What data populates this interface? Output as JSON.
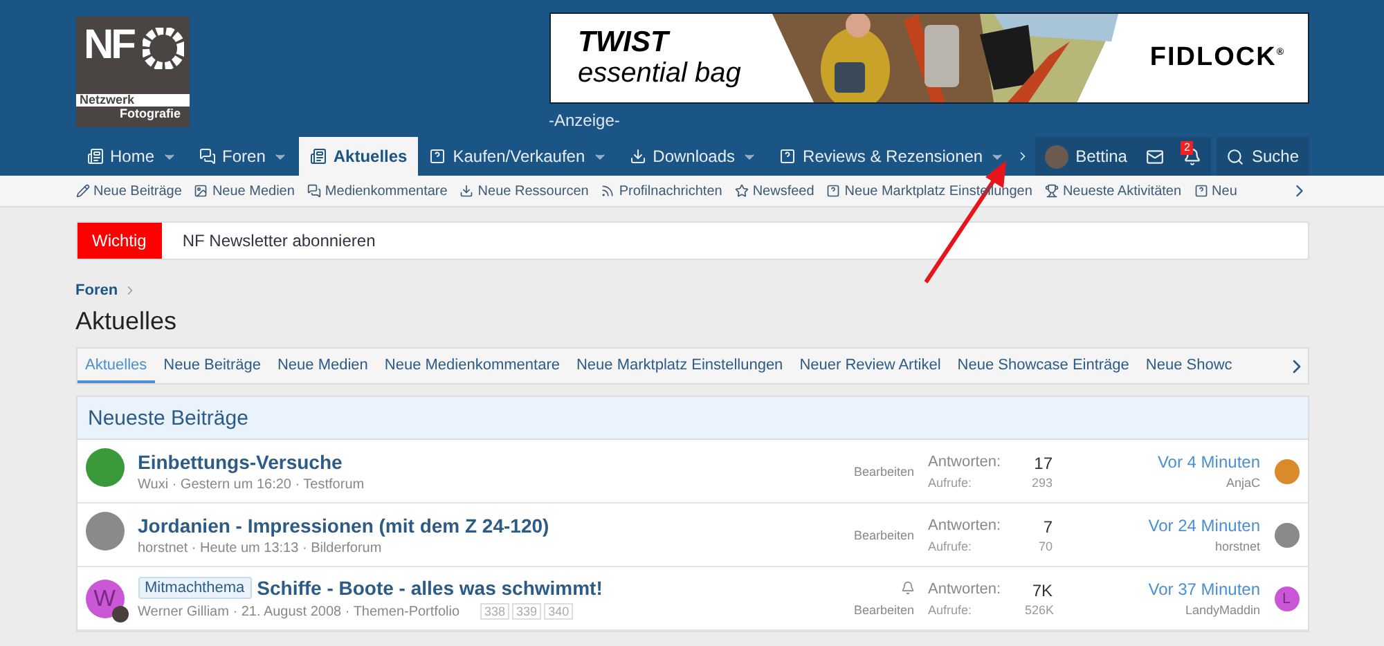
{
  "logo": {
    "letters": "NF",
    "line1": "Netzwerk",
    "line2": "Fotografie"
  },
  "ad": {
    "headline": "TWIST",
    "subline": "essential bag",
    "brand": "FIDLOCK",
    "mark": "®",
    "caption": "-Anzeige-"
  },
  "nav": [
    {
      "label": "Home",
      "dropdown": true,
      "selected": false
    },
    {
      "label": "Foren",
      "dropdown": true,
      "selected": false
    },
    {
      "label": "Aktuelles",
      "dropdown": false,
      "selected": true
    },
    {
      "label": "Kaufen/Verkaufen",
      "dropdown": true,
      "selected": false
    },
    {
      "label": "Downloads",
      "dropdown": true,
      "selected": false
    },
    {
      "label": "Reviews & Rezensionen",
      "dropdown": true,
      "selected": false
    }
  ],
  "user": {
    "name": "Bettina",
    "alerts": "2",
    "search": "Suche"
  },
  "subnav": [
    "Neue Beiträge",
    "Neue Medien",
    "Medienkommentare",
    "Neue Ressourcen",
    "Profilnachrichten",
    "Newsfeed",
    "Neue Marktplatz Einstellungen",
    "Neueste Aktivitäten",
    "Neu"
  ],
  "notice": {
    "tag": "Wichtig",
    "text": "NF Newsletter abonnieren"
  },
  "breadcrumb": "Foren",
  "title": "Aktuelles",
  "tabs": [
    {
      "label": "Aktuelles",
      "selected": true
    },
    {
      "label": "Neue Beiträge",
      "selected": false
    },
    {
      "label": "Neue Medien",
      "selected": false
    },
    {
      "label": "Neue Medienkommentare",
      "selected": false
    },
    {
      "label": "Neue Marktplatz Einstellungen",
      "selected": false
    },
    {
      "label": "Neuer Review Artikel",
      "selected": false
    },
    {
      "label": "Neue Showcase Einträge",
      "selected": false
    },
    {
      "label": "Neue Showc",
      "selected": false
    }
  ],
  "block": {
    "title": "Neueste Beiträge",
    "threads": [
      {
        "title": "Einbettungs-Versuche",
        "meta": "Wuxi · Gestern um 16:20 · Testforum",
        "watched": false,
        "edit": "Bearbeiten",
        "replies_label": "Antworten:",
        "replies": "17",
        "views_label": "Aufrufe:",
        "views": "293",
        "last_time": "Vor 4 Minuten",
        "last_user": "AnjaC"
      },
      {
        "title": "Jordanien - Impressionen (mit dem Z 24-120)",
        "meta": "horstnet · Heute um 13:13 · Bilderforum",
        "watched": false,
        "edit": "Bearbeiten",
        "replies_label": "Antworten:",
        "replies": "7",
        "views_label": "Aufrufe:",
        "views": "70",
        "last_time": "Vor 24 Minuten",
        "last_user": "horstnet"
      },
      {
        "avatar": {
          "kind": "letter",
          "letter": "W",
          "color": "#c957d6"
        },
        "prefix": "Mitmachthema",
        "title": "Schiffe - Boote - alles was schwimmt!",
        "meta": "Werner Gilliam · 21. August 2008 · Themen-Portfolio",
        "pages": [
          "338",
          "339",
          "340"
        ],
        "watched": true,
        "edit": "Bearbeiten",
        "replies_label": "Antworten:",
        "replies": "7K",
        "views_label": "Aufrufe:",
        "views": "526K",
        "last_time": "Vor 37 Minuten",
        "last_user": "LandyMaddin",
        "last_avatar": {
          "kind": "letter",
          "letter": "L",
          "color": "#c957d6"
        }
      }
    ]
  }
}
